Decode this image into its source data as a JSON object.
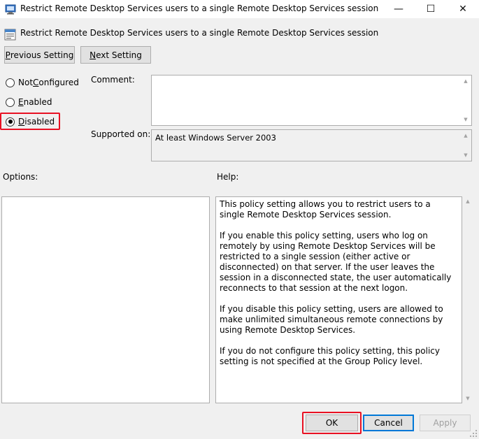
{
  "window": {
    "title": "Restrict Remote Desktop Services users to a single Remote Desktop Services session",
    "minimize_glyph": "—",
    "maximize_glyph": "☐",
    "close_glyph": "✕"
  },
  "header": {
    "title": "Restrict Remote Desktop Services users to a single Remote Desktop Services session",
    "icon": "policy-setting-icon"
  },
  "nav": {
    "previous": {
      "mnemonic": "P",
      "rest": "revious Setting"
    },
    "next": {
      "mnemonic": "N",
      "rest": "ext Setting"
    }
  },
  "state": {
    "options": [
      {
        "id": "not-configured",
        "pre": "Not ",
        "mnemonic": "C",
        "post": "onfigured",
        "checked": false
      },
      {
        "id": "enabled",
        "pre": "",
        "mnemonic": "E",
        "post": "nabled",
        "checked": false
      },
      {
        "id": "disabled",
        "pre": "",
        "mnemonic": "D",
        "post": "isabled",
        "checked": true
      }
    ]
  },
  "comment": {
    "label": "Comment:",
    "value": ""
  },
  "supported": {
    "label": "Supported on:",
    "value": "At least Windows Server 2003"
  },
  "options_panel": {
    "label": "Options:"
  },
  "help_panel": {
    "label": "Help:",
    "paragraphs": [
      "This policy setting allows you to restrict users to a single Remote Desktop Services session.",
      "If you enable this policy setting, users who log on remotely by using Remote Desktop Services will be restricted to a single session (either active or disconnected) on that server. If the user leaves the session in a disconnected state, the user automatically reconnects to that session at the next logon.",
      "If you disable this policy setting, users are allowed to make unlimited simultaneous remote connections by using Remote Desktop Services.",
      "If you do not configure this policy setting,  this policy setting is not specified at the Group Policy level."
    ]
  },
  "footer": {
    "ok": "OK",
    "cancel": "Cancel",
    "apply": "Apply"
  },
  "colors": {
    "highlight": "#e81123",
    "focus": "#0078d7"
  }
}
